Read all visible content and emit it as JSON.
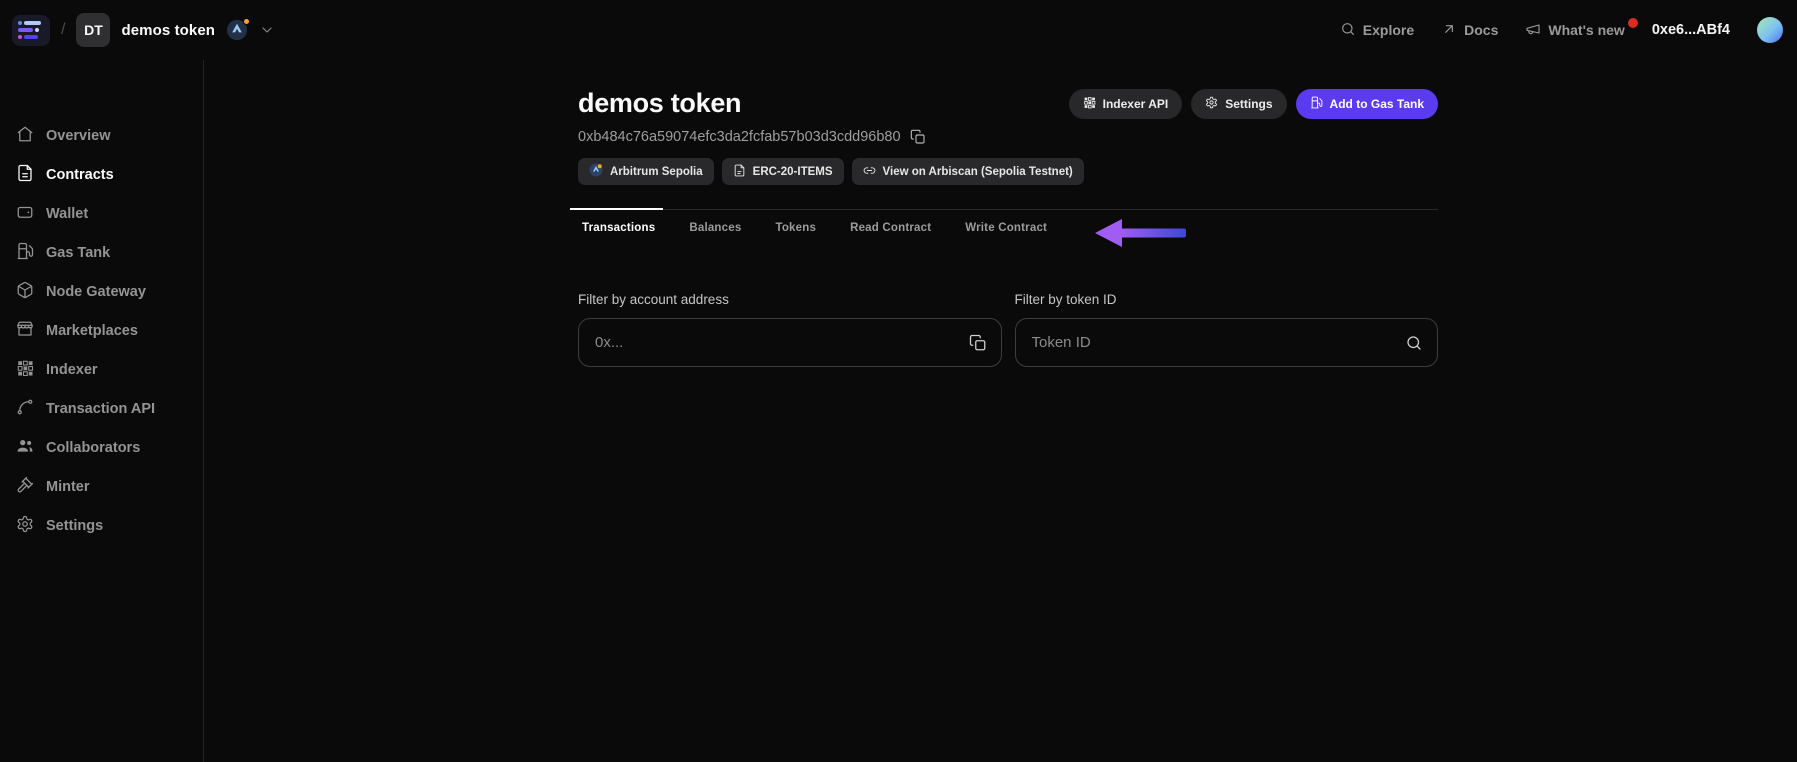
{
  "colors": {
    "accent": "#5b3bf0",
    "arrow_gradient_from": "#a15df2",
    "arrow_gradient_to": "#3c49d6",
    "notification_dot": "#d92d20",
    "network_dot": "#f5a623"
  },
  "topbar": {
    "breadcrumb_separator": "/",
    "project_avatar_initials": "DT",
    "project_name": "demos token",
    "nav_items": [
      {
        "label": "Explore",
        "icon": "search-icon"
      },
      {
        "label": "Docs",
        "icon": "external-link-icon"
      },
      {
        "label": "What's new",
        "icon": "megaphone-icon",
        "has_unread_dot": true
      }
    ],
    "wallet_address": "0xe6...ABf4"
  },
  "sidebar": {
    "items": [
      {
        "label": "Overview",
        "icon": "home-icon",
        "active": false
      },
      {
        "label": "Contracts",
        "icon": "contract-icon",
        "active": true
      },
      {
        "label": "Wallet",
        "icon": "wallet-icon",
        "active": false
      },
      {
        "label": "Gas Tank",
        "icon": "fuel-icon",
        "active": false
      },
      {
        "label": "Node Gateway",
        "icon": "cube-icon",
        "active": false
      },
      {
        "label": "Marketplaces",
        "icon": "storefront-icon",
        "active": false
      },
      {
        "label": "Indexer",
        "icon": "grid-icon",
        "active": false
      },
      {
        "label": "Transaction API",
        "icon": "spline-icon",
        "active": false
      },
      {
        "label": "Collaborators",
        "icon": "users-icon",
        "active": false
      },
      {
        "label": "Minter",
        "icon": "gavel-icon",
        "active": false
      },
      {
        "label": "Settings",
        "icon": "gear-icon",
        "active": false
      }
    ]
  },
  "main": {
    "title": "demos token",
    "contract_address": "0xb484c76a59074efc3da2fcfab57b03d3cdd96b80",
    "badges": [
      {
        "label": "Arbitrum Sepolia",
        "icon": "arbitrum-network-icon"
      },
      {
        "label": "ERC-20-ITEMS",
        "icon": "file-icon"
      },
      {
        "label": "View on Arbiscan (Sepolia Testnet)",
        "icon": "link-icon"
      }
    ],
    "actions": [
      {
        "label": "Indexer API",
        "icon": "grid-icon"
      },
      {
        "label": "Settings",
        "icon": "gear-icon"
      },
      {
        "label": "Add to Gas Tank",
        "icon": "fuel-icon",
        "variant": "primary"
      }
    ],
    "tabs": {
      "active": "Transactions",
      "items": [
        {
          "label": "Transactions"
        },
        {
          "label": "Balances"
        },
        {
          "label": "Tokens"
        },
        {
          "label": "Read Contract"
        },
        {
          "label": "Write Contract"
        }
      ]
    },
    "filters": [
      {
        "label": "Filter by account address",
        "placeholder": "0x...",
        "icon": "copy-icon"
      },
      {
        "label": "Filter by token ID",
        "placeholder": "Token ID",
        "icon": "search-icon"
      }
    ]
  }
}
